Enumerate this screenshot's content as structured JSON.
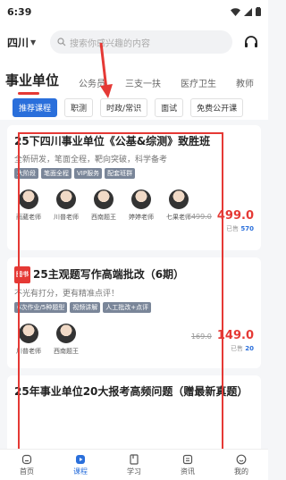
{
  "status": {
    "time": "6:39"
  },
  "header": {
    "city": "四川",
    "search_placeholder": "搜索你感兴趣的内容"
  },
  "tabs": [
    {
      "label": "事业单位",
      "active": true
    },
    {
      "label": "公务员"
    },
    {
      "label": "三支一扶"
    },
    {
      "label": "医疗卫生"
    },
    {
      "label": "教师"
    }
  ],
  "chips": [
    {
      "label": "推荐课程",
      "active": true
    },
    {
      "label": "职测"
    },
    {
      "label": "时政/常识"
    },
    {
      "label": "面试"
    },
    {
      "label": "免费公开课"
    }
  ],
  "courses": [
    {
      "title": "25下四川事业单位《公基&综测》致胜班",
      "subtitle": "全新研发，笔面全程，靶向突破，科学备考",
      "tags": [
        "大阶段",
        "笔面全程",
        "VIP服务",
        "配套班群"
      ],
      "teachers": [
        "雨葳老师",
        "川普老师",
        "西南题王",
        "婷婷老师",
        "七果老师"
      ],
      "original_price": "499.0",
      "price": "499.0",
      "sold_label": "已售",
      "sold": "570"
    },
    {
      "badge": "图书",
      "title": "25主观题写作高端批改（6期）",
      "subtitle": "不光有打分，更有精准点评！",
      "tags": [
        "6次作业/5种题型",
        "视频讲解",
        "人工批改+点评"
      ],
      "teachers": [
        "川普老师",
        "西南题王"
      ],
      "original_price": "169.0",
      "price": "149.0",
      "sold_label": "已售",
      "sold": "20"
    },
    {
      "title": "25年事业单位20大报考高频问题（赠最新真题）",
      "subtitle": ""
    }
  ],
  "bottom_nav": [
    {
      "label": "首页",
      "icon": "home-icon"
    },
    {
      "label": "课程",
      "icon": "play-icon",
      "active": true
    },
    {
      "label": "学习",
      "icon": "book-icon"
    },
    {
      "label": "资讯",
      "icon": "news-icon"
    },
    {
      "label": "我的",
      "icon": "face-icon"
    }
  ],
  "colors": {
    "accent": "#2a6fdb",
    "price": "#e53935",
    "annotation": "#e53935"
  }
}
